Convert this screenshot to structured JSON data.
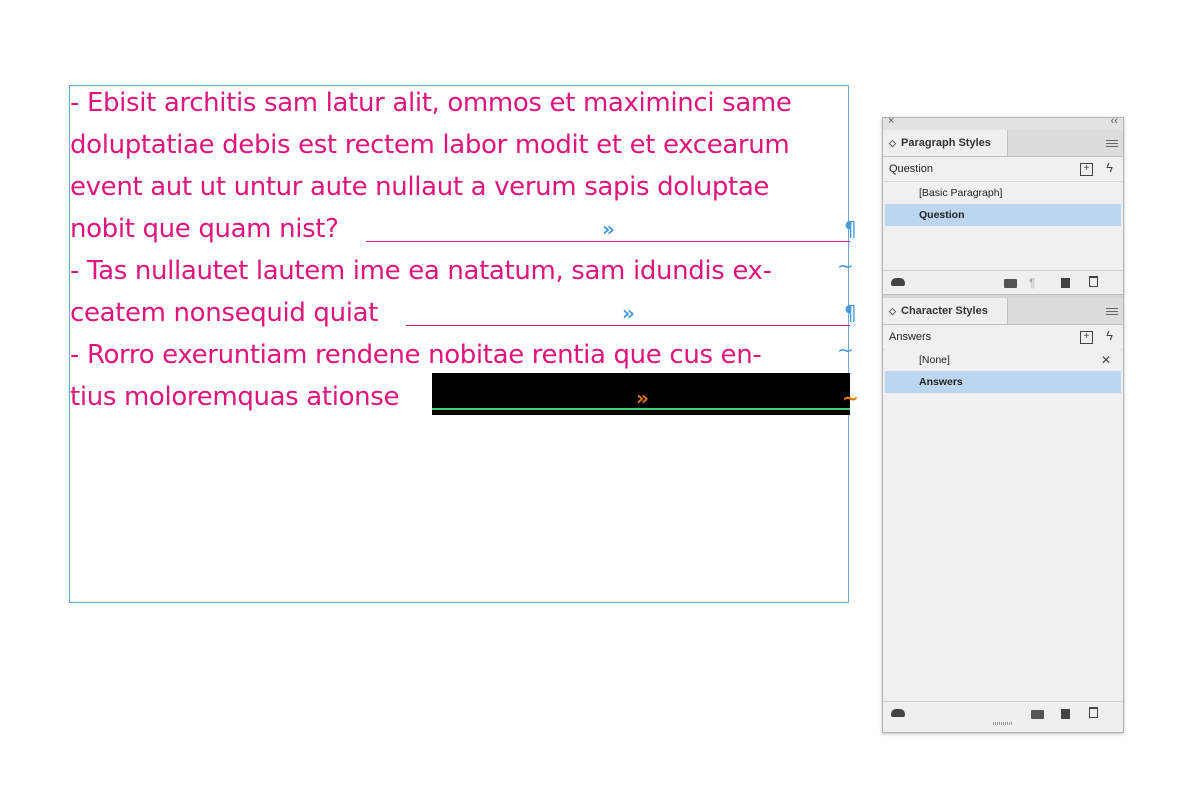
{
  "document": {
    "lines": [
      "- Ebisit architis sam latur alit, ommos et maximinci same",
      "doluptatiae debis est rectem labor modit et et excearum",
      "event aut ut untur aute nullaut a verum sapis doluptae",
      "nobit que quam nist?",
      "- Tas nullautet lautem ime ea natatum, sam idundis ex-",
      "ceatem nonsequid quiat",
      "- Rorro exeruntiam rendene nobitae rentia que cus en-",
      "tius moloremquas ationse"
    ],
    "pilcrow": "¶",
    "tab_marker": "»",
    "hyphen_marker": "~",
    "text_color": "#e0157b",
    "invisibles_color": "#4a9bd8"
  },
  "panel": {
    "paragraph_styles": {
      "tab_label": "Paragraph Styles",
      "current": "Question",
      "items": [
        "[Basic Paragraph]",
        "Question"
      ],
      "selected": "Question"
    },
    "character_styles": {
      "tab_label": "Character Styles",
      "current": "Answers",
      "items": [
        "[None]",
        "Answers"
      ],
      "selected": "Answers"
    },
    "icons": [
      "close-icon",
      "collapse-icon",
      "panel-menu-icon",
      "new-style-icon",
      "lightning-icon",
      "cc-library-icon",
      "folder-icon",
      "clear-overrides-icon",
      "new-page-icon",
      "trash-icon",
      "pencil-cross-icon"
    ],
    "selection_color": "#bcd5f0"
  }
}
